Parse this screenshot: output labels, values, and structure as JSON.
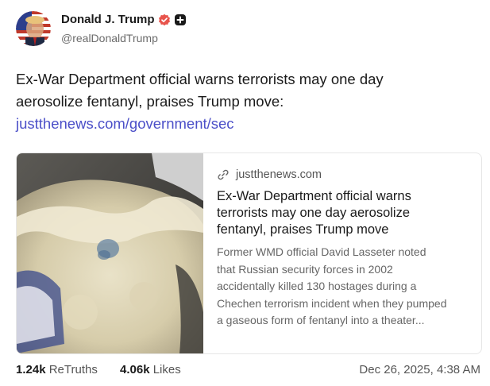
{
  "author": {
    "name": "Donald J. Trump",
    "handle": "@realDonaldTrump",
    "avatar_icon": "avatar-flag-portrait",
    "verified_icon": "verified-badge-icon",
    "verified_color": "#e8544c",
    "plus_icon": "plus-badge-icon"
  },
  "post": {
    "text_line1": "Ex-War Department official warns terrorists may one day",
    "text_line2": "aerosolize fentanyl, praises Trump move:",
    "link_text": "justthenews.com/government/sec",
    "link_color": "#4b4fc8"
  },
  "link_card": {
    "domain": "justthenews.com",
    "domain_icon": "link-icon",
    "title": "Ex-War Department official warns terrorists may one day aerosolize fentanyl, praises Trump move",
    "description": "Former WMD official David Lasseter noted that Russian security forces in 2002 accidentally killed 130 hostages during a Chechen terrorism incident when they pumped a gaseous form of fentanyl into a theater...",
    "image": "powder-in-container-photo"
  },
  "stats": {
    "retruths_count": "1.24k",
    "retruths_label": "ReTruths",
    "likes_count": "4.06k",
    "likes_label": "Likes"
  },
  "timestamp": "Dec 26, 2025, 4:38 AM"
}
